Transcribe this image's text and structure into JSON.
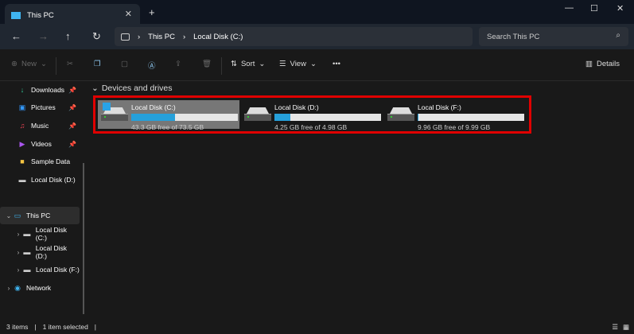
{
  "tab": {
    "title": "This PC",
    "icon": "monitor-icon"
  },
  "address": {
    "crumbs": [
      "This PC",
      "Local Disk (C:)"
    ],
    "search_placeholder": "Search This PC"
  },
  "toolbar": {
    "new": "New",
    "sort": "Sort",
    "view": "View",
    "more": "•••",
    "details": "Details"
  },
  "sidebar": [
    {
      "label": "Downloads",
      "icon": "download-icon",
      "pinned": true
    },
    {
      "label": "Pictures",
      "icon": "pictures-icon",
      "pinned": true
    },
    {
      "label": "Music",
      "icon": "music-icon",
      "pinned": true
    },
    {
      "label": "Videos",
      "icon": "videos-icon",
      "pinned": true
    },
    {
      "label": "Sample Data",
      "icon": "folder-icon",
      "pinned": false
    },
    {
      "label": "Local Disk (D:)",
      "icon": "drive-icon",
      "pinned": false
    },
    {
      "label": "This PC",
      "icon": "monitor-icon",
      "selected": true
    },
    {
      "label": "Local Disk (C:)",
      "icon": "drive-icon"
    },
    {
      "label": "Local Disk (D:)",
      "icon": "drive-icon"
    },
    {
      "label": "Local Disk (F:)",
      "icon": "drive-icon"
    },
    {
      "label": "Network",
      "icon": "network-icon"
    }
  ],
  "group": "Devices and drives",
  "drives": [
    {
      "name": "Local Disk (C:)",
      "free": "43.3 GB free of 73.5 GB",
      "used_fraction": 0.41,
      "selected": true
    },
    {
      "name": "Local Disk (D:)",
      "free": "4.25 GB free of 4.98 GB",
      "used_fraction": 0.15
    },
    {
      "name": "Local Disk (F:)",
      "free": "9.96 GB free of 9.99 GB",
      "used_fraction": 0.003
    }
  ],
  "status": {
    "items": "3 items",
    "selected": "1 item selected"
  },
  "colors": {
    "accent": "#26a0da",
    "highlight": "#e00000"
  }
}
